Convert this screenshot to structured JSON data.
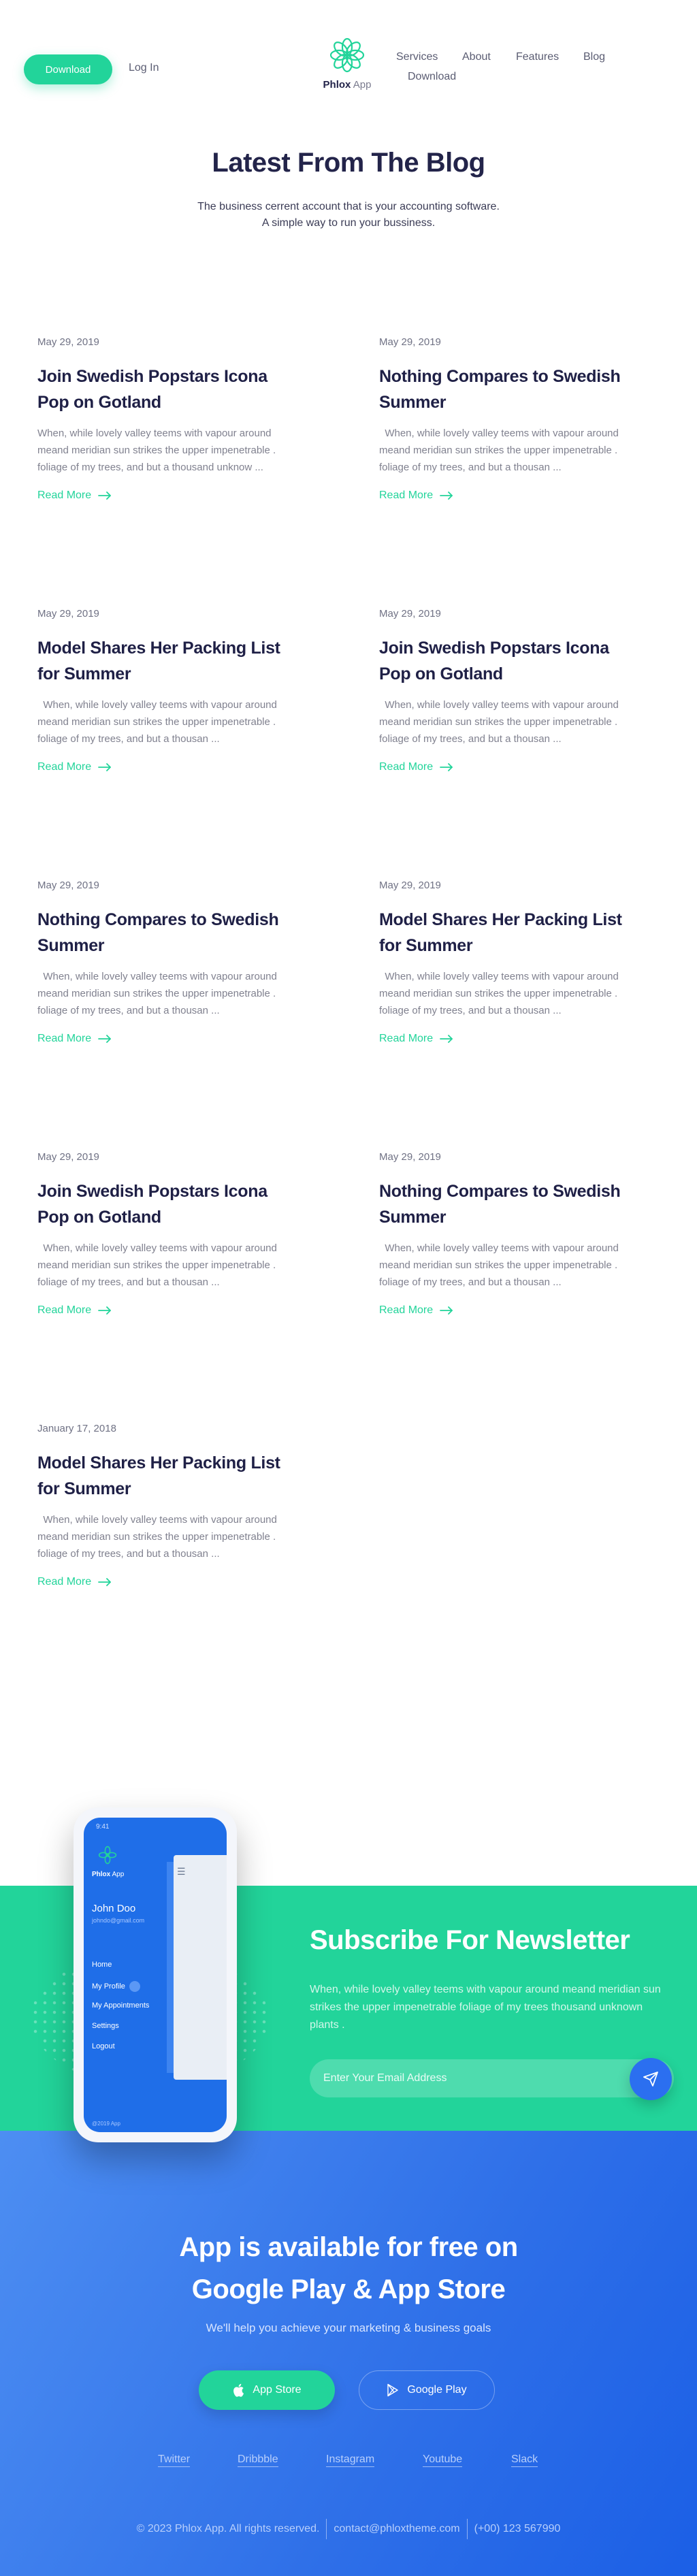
{
  "header": {
    "download_label": "Download",
    "login_label": "Log In",
    "logo_bold": "Phlox",
    "logo_light": "App",
    "nav": [
      "Services",
      "About",
      "Features",
      "Blog",
      "Download"
    ]
  },
  "blog": {
    "title": "Latest From The Blog",
    "subtitle_line1": "The business cerrent account that is your accounting software.",
    "subtitle_line2": "A simple way to run your bussiness.",
    "read_more": "Read More",
    "posts": [
      {
        "date": "May 29, 2019",
        "title": "Join Swedish Popstars Icona Pop on Gotland",
        "excerpt": "When, while lovely valley teems with vapour around meand meridian sun strikes the upper impenetrable . foliage of my trees, and but a thousand unknow ..."
      },
      {
        "date": "May 29, 2019",
        "title": "Nothing Compares to Swedish Summer",
        "excerpt": "  When, while lovely valley teems with vapour around meand meridian sun strikes the upper impenetrable . foliage of my trees, and but a thousan ..."
      },
      {
        "date": "May 29, 2019",
        "title": "Model Shares Her Packing List for Summer",
        "excerpt": "  When, while lovely valley teems with vapour around meand meridian sun strikes the upper impenetrable . foliage of my trees, and but a thousan ..."
      },
      {
        "date": "May 29, 2019",
        "title": "Join Swedish Popstars Icona Pop on Gotland",
        "excerpt": "  When, while lovely valley teems with vapour around meand meridian sun strikes the upper impenetrable . foliage of my trees, and but a thousan ..."
      },
      {
        "date": "May 29, 2019",
        "title": "Nothing Compares to Swedish Summer",
        "excerpt": "  When, while lovely valley teems with vapour around meand meridian sun strikes the upper impenetrable . foliage of my trees, and but a thousan ..."
      },
      {
        "date": "May 29, 2019",
        "title": "Model Shares Her Packing List for Summer",
        "excerpt": "  When, while lovely valley teems with vapour around meand meridian sun strikes the upper impenetrable . foliage of my trees, and but a thousan ..."
      },
      {
        "date": "May 29, 2019",
        "title": "Join Swedish Popstars Icona Pop on Gotland",
        "excerpt": "  When, while lovely valley teems with vapour around meand meridian sun strikes the upper impenetrable . foliage of my trees, and but a thousan ..."
      },
      {
        "date": "May 29, 2019",
        "title": "Nothing Compares to Swedish Summer",
        "excerpt": "  When, while lovely valley teems with vapour around meand meridian sun strikes the upper impenetrable . foliage of my trees, and but a thousan ..."
      },
      {
        "date": "January 17, 2018",
        "title": "Model Shares Her Packing List for Summer",
        "excerpt": "  When, while lovely valley teems with vapour around meand meridian sun strikes the upper impenetrable . foliage of my trees, and but a thousan ..."
      }
    ]
  },
  "phone": {
    "time": "9:41",
    "brand_bold": "Phlox",
    "brand_light": "App",
    "user_name": "John Doo",
    "user_email": "johndo@gmail.com",
    "menu": [
      "Home",
      "My Profile",
      "My Appointments",
      "Settings",
      "Logout"
    ],
    "copyright": "@2019 App"
  },
  "newsletter": {
    "title": "Subscribe For Newsletter",
    "text": "When, while lovely valley teems with vapour around meand meridian sun strikes the upper impenetrable foliage of my trees thousand unknown plants .",
    "email_placeholder": "Enter Your Email Address"
  },
  "app_section": {
    "title_line1": "App is available for free on",
    "title_line2": "Google Play & App Store",
    "subtitle": "We'll help you achieve your marketing & business goals",
    "appstore_label": "App Store",
    "googleplay_label": "Google Play",
    "social": [
      "Twitter",
      "Dribbble",
      "Instagram",
      "Youtube",
      "Slack"
    ]
  },
  "footer": {
    "copyright": "© 2023 Phlox App. All rights reserved.",
    "email": "contact@phloxtheme.com",
    "phone": "(+00) 123 567990"
  },
  "colors": {
    "accent_green": "#22d49a",
    "accent_blue": "#2e6fe8",
    "heading": "#23244a"
  }
}
